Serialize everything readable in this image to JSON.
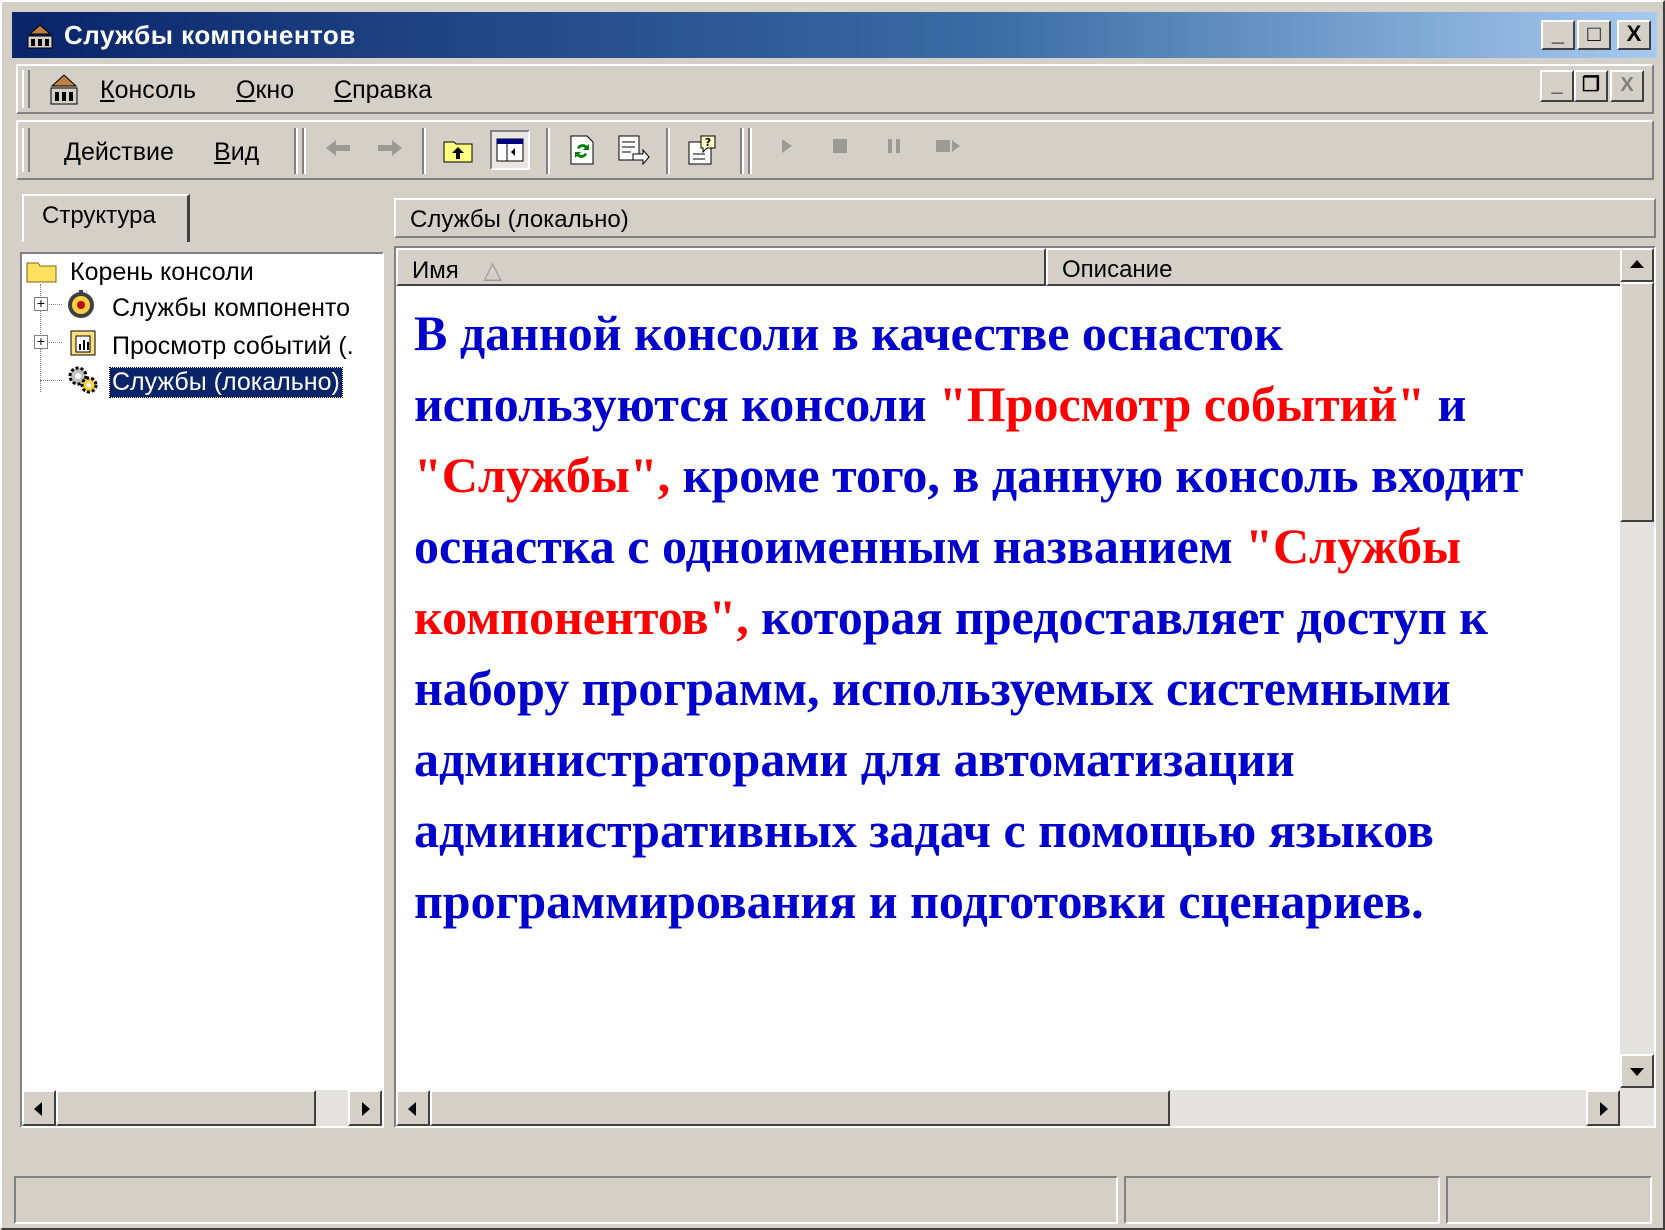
{
  "window": {
    "title": "Службы компонентов",
    "controls": {
      "minimize": "_",
      "maximize": "□",
      "close": "X"
    }
  },
  "menubar": {
    "items": [
      {
        "label_prefix": "",
        "accel": "К",
        "label_rest": "онсоль"
      },
      {
        "label_prefix": "",
        "accel": "О",
        "label_rest": "кно"
      },
      {
        "label_prefix": "",
        "accel": "С",
        "label_rest": "правка"
      }
    ],
    "mdi_controls": {
      "minimize": "_",
      "restore": "❐",
      "close": "X"
    }
  },
  "toolbar": {
    "action_accel": "Д",
    "action_rest": "ействие",
    "view_accel": "В",
    "view_rest": "ид",
    "icons": [
      "back-arrow-icon",
      "forward-arrow-icon",
      "up-folder-icon",
      "show-hide-tree-icon",
      "refresh-icon",
      "export-list-icon",
      "help-icon",
      "start-icon",
      "stop-icon",
      "pause-icon",
      "restart-icon"
    ]
  },
  "left_pane": {
    "tab_label": "Структура",
    "tree": [
      {
        "label": "Корень консоли",
        "icon": "folder-icon",
        "expander": ""
      },
      {
        "label": "Службы компоненто",
        "icon": "component-services-icon",
        "expander": "+"
      },
      {
        "label": "Просмотр событий (.",
        "icon": "event-viewer-icon",
        "expander": "+"
      },
      {
        "label": "Службы (локально)",
        "icon": "services-gear-icon",
        "expander": "",
        "selected": true
      }
    ]
  },
  "right_pane": {
    "header": "Службы (локально)",
    "columns": [
      {
        "label": "Имя",
        "sort": "△"
      },
      {
        "label": "Описание"
      }
    ]
  },
  "overlay": {
    "p1": "В данной консоли в качестве оснасток используются консоли ",
    "p2": "\"Просмотр событий\"",
    "p3": " и ",
    "p4": "\"Службы\",",
    "p5": " кроме того, в данную консоль входит оснастка с одноименным названием ",
    "p6": "\"Службы компонентов\",",
    "p7": " которая предоставляет доступ к набору программ, используемых системными администраторами для автоматизации административных задач с помощью языков программирования и подготовки сценариев.",
    "colors": {
      "main": "#0000cc",
      "highlight": "#ff0000"
    }
  },
  "statusbar": {
    "cells": [
      "",
      "",
      ""
    ]
  }
}
